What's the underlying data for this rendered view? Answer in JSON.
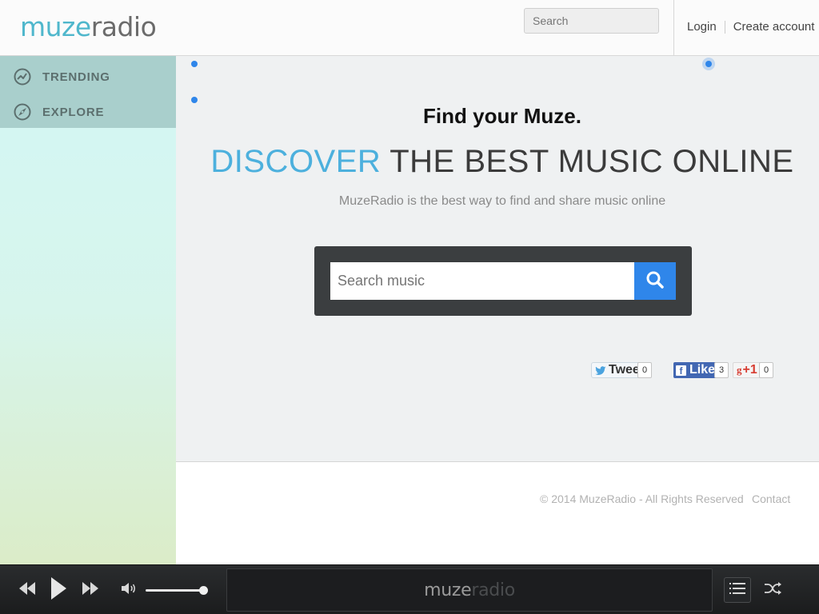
{
  "header": {
    "logo_muze": "muze",
    "logo_radio": "radio",
    "search_placeholder": "Search",
    "login": "Login",
    "create_account": "Create account"
  },
  "sidebar": {
    "items": [
      {
        "label": "TRENDING",
        "icon": "trending-icon"
      },
      {
        "label": "EXPLORE",
        "icon": "compass-icon"
      }
    ]
  },
  "main": {
    "tagline": "Find your Muze.",
    "headline_accent": "DISCOVER",
    "headline_rest": " THE BEST MUSIC ONLINE",
    "subtitle": "MuzeRadio is the best way to find and share music online",
    "search_placeholder": "Search music",
    "search_icon": "search-icon"
  },
  "social": {
    "tweet_label": "Tweet",
    "tweet_count": "0",
    "like_label": "Like",
    "like_count": "3",
    "gplus_label": "+1",
    "gplus_count": "0"
  },
  "footer": {
    "copyright": "© 2014 MuzeRadio - All Rights Reserved",
    "contact": "Contact"
  },
  "player": {
    "logo_muze": "muze",
    "logo_radio": "radio",
    "volume_level": 0.95
  },
  "colors": {
    "accent": "#4cb0dd",
    "brand_blue": "#2f86ea",
    "sidebar_nav_bg": "#a9cfcc"
  }
}
